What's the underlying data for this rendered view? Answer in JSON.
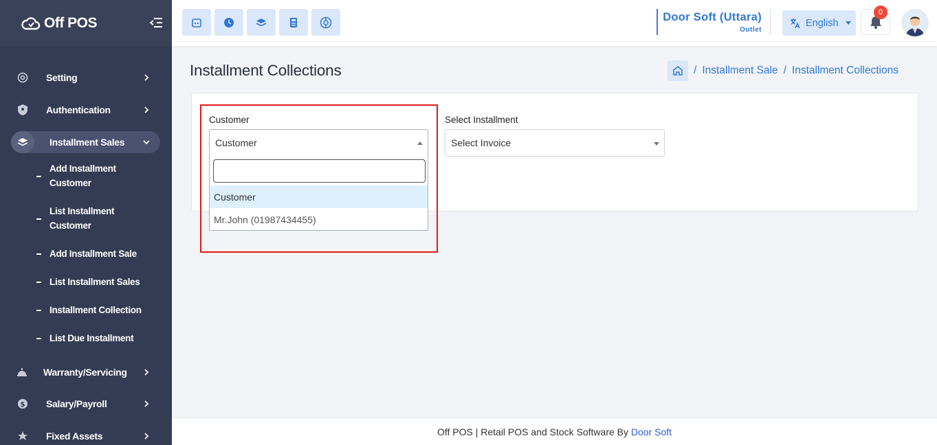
{
  "app": {
    "logo_text": "Off POS"
  },
  "sidebar": {
    "items": [
      {
        "label": "Setting",
        "icon": "gear-icon"
      },
      {
        "label": "Authentication",
        "icon": "shield-icon"
      },
      {
        "label": "Installment Sales",
        "icon": "layers-icon",
        "expanded": true
      },
      {
        "label": "Warranty/Servicing",
        "icon": "service-bell-icon"
      },
      {
        "label": "Salary/Payroll",
        "icon": "dollar-icon"
      },
      {
        "label": "Fixed Assets",
        "icon": "asset-icon"
      }
    ],
    "sub_items": [
      "Add Installment Customer",
      "List Installment Customer",
      "Add Installment Sale",
      "List Installment Sales",
      "Installment Collection",
      "List Due Installment"
    ]
  },
  "header": {
    "quick_buttons": [
      "pos-register-icon",
      "clock-icon",
      "layers-icon",
      "calculator-icon",
      "settings-wheel-icon"
    ],
    "outlet_name": "Door Soft (Uttara)",
    "outlet_label": "Outlet",
    "language": "English",
    "notification_count": "0"
  },
  "page": {
    "title": "Installment Collections",
    "breadcrumb": [
      "Installment Sale",
      "Installment Collections"
    ]
  },
  "form": {
    "customer_label": "Customer",
    "customer_value": "Customer",
    "installment_label": "Select Installment",
    "installment_value": "Select Invoice",
    "search_value": "",
    "options": [
      "Customer",
      "Mr.John (01987434455)"
    ]
  },
  "footer": {
    "text": "Off POS | Retail POS and Stock Software By",
    "link": "Door Soft"
  },
  "colors": {
    "sidebar": "#343c53",
    "accent": "#2f78d8",
    "highlight": "#e01a1a",
    "badge": "#ee4a3b"
  }
}
